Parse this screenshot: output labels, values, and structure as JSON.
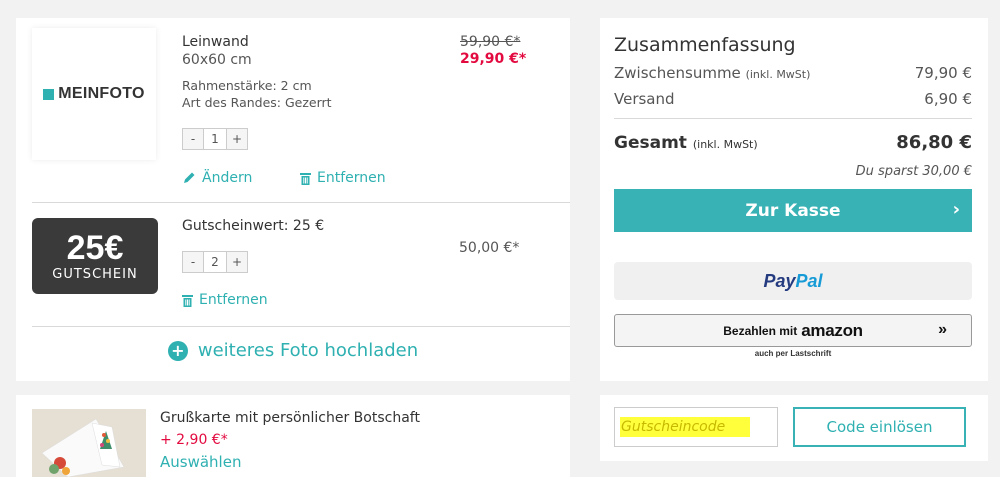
{
  "cart": {
    "items": [
      {
        "logo_text": "MEINFOTO",
        "title": "Leinwand",
        "size": "60x60 cm",
        "meta1": "Rahmenstärke: 2 cm",
        "meta2": "Art des Randes: Gezerrt",
        "price_old": "59,90 €*",
        "price_new": "29,90 €*",
        "qty_minus": "-",
        "qty": "1",
        "qty_plus": "+",
        "edit_label": "Ändern",
        "remove_label": "Entfernen"
      },
      {
        "thumb_amount": "25€",
        "thumb_label": "GUTSCHEIN",
        "title": "Gutscheinwert: 25 €",
        "price": "50,00 €*",
        "qty_minus": "-",
        "qty": "2",
        "qty_plus": "+",
        "remove_label": "Entfernen"
      }
    ],
    "upload_label": "weiteres Foto hochladen"
  },
  "greeting_card": {
    "title": "Grußkarte mit persönlicher Botschaft",
    "price": "+ 2,90 €*",
    "select_label": "Auswählen"
  },
  "summary": {
    "title": "Zusammenfassung",
    "subtotal_label": "Zwischensumme",
    "subtotal_note": "(inkl. MwSt)",
    "subtotal_value": "79,90 €",
    "shipping_label": "Versand",
    "shipping_value": "6,90 €",
    "total_label": "Gesamt",
    "total_note": "(inkl. MwSt)",
    "total_value": "86,80 €",
    "savings": "Du sparst 30,00 €",
    "checkout_label": "Zur Kasse",
    "paypal_part1": "Pay",
    "paypal_part2": "Pal",
    "amazon_prefix": "Bezahlen mit",
    "amazon_brand": "amazon",
    "amazon_note": "auch per Lastschrift"
  },
  "coupon": {
    "placeholder": "Gutscheincode",
    "redeem_label": "Code einlösen"
  },
  "colors": {
    "accent": "#38b2b5",
    "sale": "#e30a40",
    "background": "#f2f2f2"
  }
}
